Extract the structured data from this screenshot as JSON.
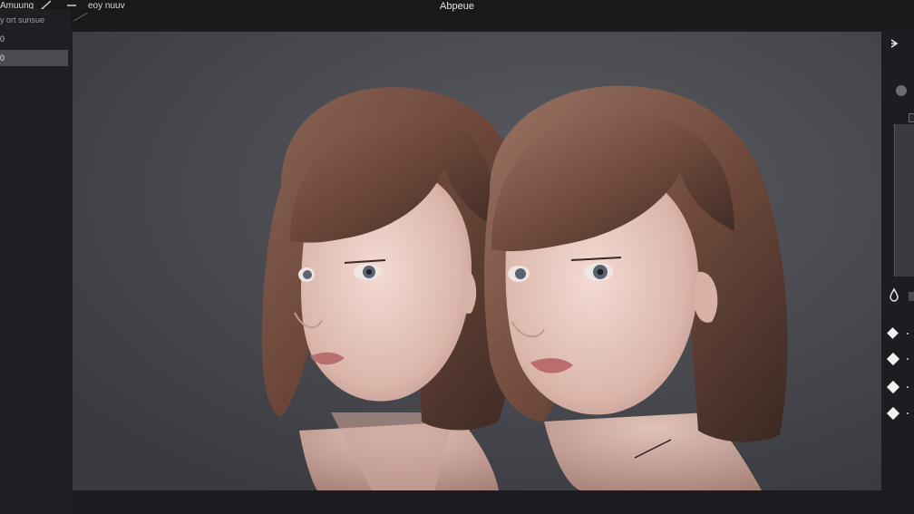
{
  "window": {
    "title": "Abpeue"
  },
  "toolbar": {
    "menu_left": "Amuung",
    "menu_right": "eoy nuuv"
  },
  "left_panel": {
    "header": "y ort sunsue",
    "items": [
      {
        "label": "0",
        "selected": false
      },
      {
        "label": "0",
        "selected": true
      }
    ]
  },
  "canvas": {
    "background": "#48494e",
    "subject": "two-portraits"
  },
  "right_panel": {
    "top_icon": "pin-icon",
    "tool_icon": "drop-icon",
    "keyframes": [
      {
        "icon": "diamond-icon"
      },
      {
        "icon": "diamond-icon"
      },
      {
        "icon": "diamond-icon"
      },
      {
        "icon": "diamond-icon"
      }
    ]
  },
  "colors": {
    "app_bg": "#1b1c1f",
    "panel_bg": "#1e1f22",
    "selection": "#4a4b50",
    "hair": "#6e4a3c",
    "skin": "#e9cfc6"
  }
}
